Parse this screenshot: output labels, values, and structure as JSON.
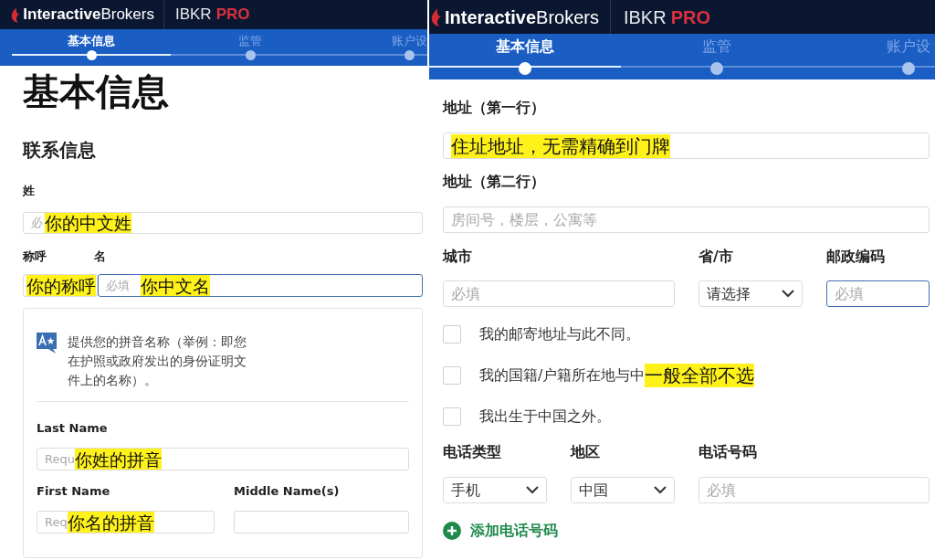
{
  "left_panel": {
    "header": {
      "brand_bold": "Interactive",
      "brand_light": "Brokers",
      "product": "IBKR",
      "product_tier": "PRO"
    },
    "steps": [
      {
        "label": "基本信息",
        "selected": true
      },
      {
        "label": "监管",
        "selected": false
      },
      {
        "label": "账户设",
        "selected": false
      }
    ],
    "title": "基本信息",
    "section": "联系信息",
    "surname": {
      "label": "姓",
      "placeholder": "必",
      "note": "你的中文姓"
    },
    "salutation": {
      "label": "称呼",
      "note": "你的称呼"
    },
    "given_name": {
      "label": "名",
      "placeholder": "必填",
      "note": "你中文名",
      "focused": true
    },
    "pinyin_card": {
      "hint": "提供您的拼音名称（举例：即您在护照或政府发出的身份证明文件上的名称）。",
      "last_name": {
        "label": "Last Name",
        "placeholder": "Requ",
        "note": "你姓的拼音"
      },
      "first_name": {
        "label": "First Name",
        "placeholder": "Req",
        "note": "你名的拼音"
      },
      "middle_name": {
        "label": "Middle Name(s)"
      }
    }
  },
  "right_panel": {
    "header": {
      "brand_bold": "Interactive",
      "brand_light": "Brokers",
      "product": "IBKR",
      "product_tier": "PRO"
    },
    "steps": [
      {
        "label": "基本信息",
        "selected": true
      },
      {
        "label": "监管",
        "selected": false
      },
      {
        "label": "账户设",
        "selected": false
      }
    ],
    "address1": {
      "label": "地址（第一行）",
      "note": "住址地址，无需精确到门牌"
    },
    "address2": {
      "label": "地址（第二行）",
      "placeholder": "房间号，楼层，公寓等"
    },
    "city": {
      "label": "城市",
      "placeholder": "必填"
    },
    "province": {
      "label": "省/市",
      "value": "请选择"
    },
    "postal": {
      "label": "邮政编码",
      "placeholder": "必填",
      "focused": true
    },
    "checkboxes": [
      {
        "label": "我的邮寄地址与此不同。",
        "checked": false
      },
      {
        "label": "我的国籍/户籍所在地与中",
        "checked": false,
        "note": "一般全部不选"
      },
      {
        "label": "我出生于中国之外。",
        "checked": false
      }
    ],
    "phone_type": {
      "label": "电话类型",
      "value": "手机"
    },
    "region": {
      "label": "地区",
      "value": "中国"
    },
    "phone": {
      "label": "电话号码",
      "placeholder": "必填"
    },
    "add_phone": "添加电话号码"
  }
}
